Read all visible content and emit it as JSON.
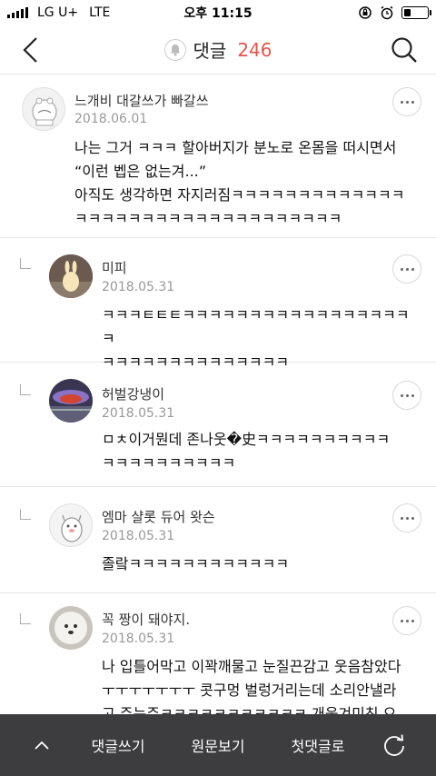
{
  "status_bar": {
    "carrier": "LG U+",
    "network": "LTE",
    "time": "오후 11:15"
  },
  "header": {
    "title": "댓글",
    "count": "246"
  },
  "comments": [
    {
      "author": "느개비 대갈쓰가 빠갈쓰",
      "date": "2018.06.01",
      "text": "나는 그거 ㅋㅋㅋ 할아버지가 분노로 온몸을 떠시면서\n“이런 벱은 없는겨...”\n아직도 생각하면 자지러짐ㅋㅋㅋㅋㅋㅋㅋㅋㅋㅋㅋㅋㅋ\nㅋㅋㅋㅋㅋㅋㅋㅋㅋㅋㅋㅋㅋㅋㅋㅋㅋㅋㅋㅋ"
    },
    {
      "author": "미피",
      "date": "2018.05.31",
      "text": "ㅋㅋㅋㅌㅌㅌㅋㅋㅋㅋㅋㅋㅋㅋㅋㅋㅋㅋㅋㅋㅋㅋㅋㅋ\nㅋㅋㅋㅋㅋㅋㅋㅋㅋㅋㅋㅋㅋㅋ"
    },
    {
      "author": "허벌강냉이",
      "date": "2018.05.31",
      "text": "ㅁㅊ이거뭔데 존나웃�史ㅋㅋㅋㅋㅋㅋㅋㅋㅋㅋ\nㅋㅋㅋㅋㅋㅋㅋㅋㅋㅋ"
    },
    {
      "author": "엠마 샬롯 듀어 왓슨",
      "date": "2018.05.31",
      "text": "졸랔ㅋㅋㅋㅋㅋㅋㅋㅋㅋㅋㅋㅋ"
    },
    {
      "author": "꼭 짱이 돼야지.",
      "date": "2018.05.31",
      "text": "나 입틀어막고 이꽉깨물고 눈질끈감고 웃음참았다\nㅜㅜㅜㅜㅜㅜㅜ 콧구멍 벌렁거리는데 소리안낼라\n고 주는주ㅋㅋㅋㅋㅋㅋㅋㅋㅋㅋㅋ 개웃겨미친 으"
    }
  ],
  "bottom_bar": {
    "write": "댓글쓰기",
    "original": "원문보기",
    "first": "첫댓글로"
  }
}
